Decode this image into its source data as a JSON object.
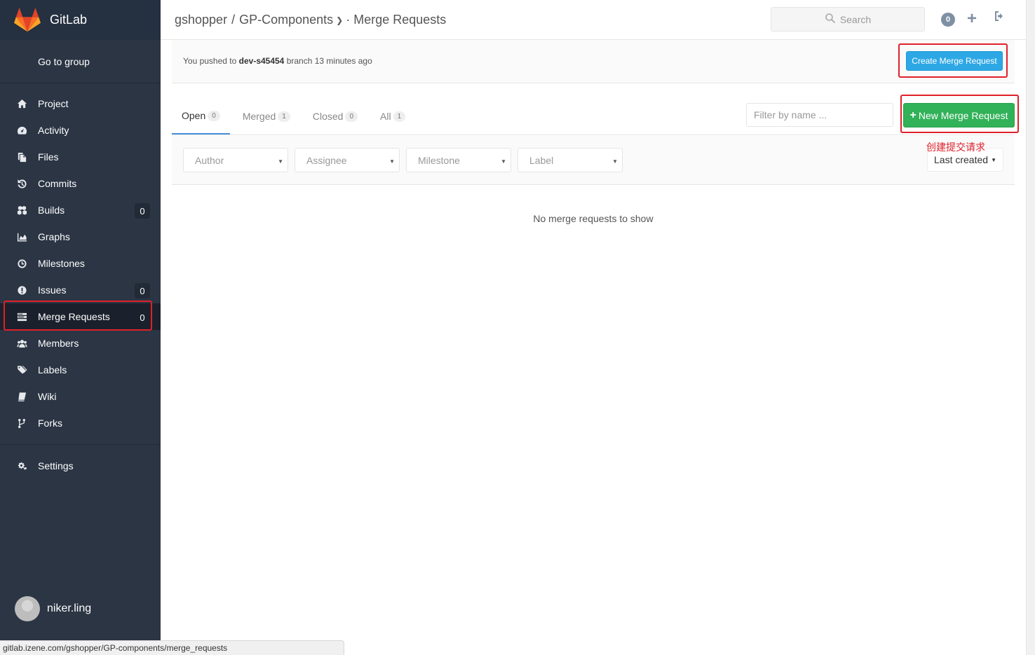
{
  "app": {
    "name": "GitLab"
  },
  "sidebar": {
    "go_to_group": "Go to group",
    "items": [
      {
        "label": "Project",
        "icon": "home-icon"
      },
      {
        "label": "Activity",
        "icon": "dashboard-icon"
      },
      {
        "label": "Files",
        "icon": "files-icon"
      },
      {
        "label": "Commits",
        "icon": "history-icon"
      },
      {
        "label": "Builds",
        "icon": "cubes-icon",
        "count": "0"
      },
      {
        "label": "Graphs",
        "icon": "area-chart-icon"
      },
      {
        "label": "Milestones",
        "icon": "clock-icon"
      },
      {
        "label": "Issues",
        "icon": "exclamation-circle-icon",
        "count": "0"
      },
      {
        "label": "Merge Requests",
        "icon": "tasks-icon",
        "count": "0",
        "active": true
      },
      {
        "label": "Members",
        "icon": "users-icon"
      },
      {
        "label": "Labels",
        "icon": "tags-icon"
      },
      {
        "label": "Wiki",
        "icon": "book-icon"
      },
      {
        "label": "Forks",
        "icon": "code-fork-icon"
      }
    ],
    "settings": "Settings",
    "user": "niker.ling"
  },
  "header": {
    "group": "gshopper",
    "separator": "/",
    "project": "GP-Components",
    "section": "· Merge Requests",
    "search_placeholder": "Search",
    "todo_count": "0"
  },
  "alert": {
    "prefix": "You pushed to ",
    "branch": "dev-s45454",
    "suffix": " branch 13 minutes ago",
    "create_button": "Create Merge Request"
  },
  "tabs": [
    {
      "label": "Open",
      "count": "0"
    },
    {
      "label": "Merged",
      "count": "1"
    },
    {
      "label": "Closed",
      "count": "0"
    },
    {
      "label": "All",
      "count": "1"
    }
  ],
  "filter_placeholder": "Filter by name ...",
  "new_button": "New Merge Request",
  "filters": [
    "Author",
    "Assignee",
    "Milestone",
    "Label"
  ],
  "sort": "Last created",
  "annotation": "创建提交请求",
  "empty_message": "No merge requests to show",
  "status_url": "gitlab.izene.com/gshopper/GP-components/merge_requests",
  "colors": {
    "sidebar_bg": "#2b3544",
    "create_button": "#2ea8e5",
    "new_button": "#31b158",
    "highlight_box": "#e0202a"
  }
}
